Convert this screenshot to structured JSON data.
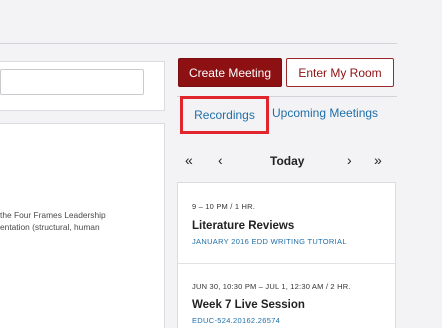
{
  "left": {
    "description_lines": [
      "the Four Frames Leadership",
      "entation (structural, human"
    ]
  },
  "actions": {
    "create_label": "Create Meeting",
    "enter_label": "Enter My Room"
  },
  "tabs": [
    {
      "label": "Recordings",
      "highlighted": true
    },
    {
      "label": "Upcoming Meetings",
      "highlighted": false
    }
  ],
  "calendar_nav": {
    "double_prev": "«",
    "prev": "‹",
    "today": "Today",
    "next": "›",
    "double_next": "»"
  },
  "events": [
    {
      "time": "9 – 10 PM / 1 HR.",
      "title": "Literature Reviews",
      "subtitle": "JANUARY 2016 EDD WRITING TUTORIAL"
    },
    {
      "time": "JUN 30, 10:30 PM – JUL 1, 12:30 AM / 2 HR.",
      "title": "Week 7 Live Session",
      "subtitle": "EDUC-524.20162.26574"
    }
  ],
  "colors": {
    "brand": "#8d1113",
    "link": "#1f6fa8",
    "highlight": "#e0262c"
  }
}
